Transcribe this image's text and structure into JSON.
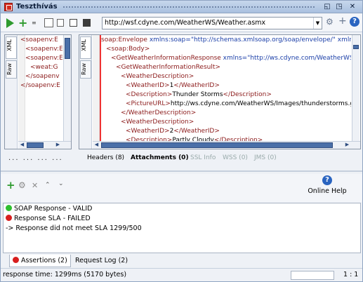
{
  "window": {
    "title": "Teszthívás"
  },
  "toolbar": {
    "url": "http://wsf.cdyne.com/WeatherWS/Weather.asmx"
  },
  "request_panel": {
    "tabs": [
      "XML",
      "Raw"
    ],
    "lines": [
      {
        "t": "<soapenv:E"
      },
      {
        "t": "<soapenv:E"
      },
      {
        "t": "<soapenv:E"
      },
      {
        "t": "<weat:G"
      },
      {
        "t": "</soapenv"
      },
      {
        "t": "</soapenv:E"
      }
    ],
    "more": "... ... ... ..."
  },
  "response_panel": {
    "tabs": [
      "XML",
      "Raw"
    ],
    "lines": [
      {
        "indent": 0,
        "tag": "soap:Envelope",
        "attr": " xmlns:soap=",
        "val": "\"http://schemas.xmlsoap.org/soap/envelope/\"",
        "rest": " xmlns:xsi="
      },
      {
        "indent": 1,
        "tag": "<soap:Body>"
      },
      {
        "indent": 2,
        "tag": "<GetWeatherInformationResponse",
        "attr": " xmlns=",
        "val": "\"http://ws.cdyne.com/WeatherWS/\"",
        "close": ">"
      },
      {
        "indent": 3,
        "tag": "<GetWeatherInformationResult>"
      },
      {
        "indent": 4,
        "tag": "<WeatherDescription>"
      },
      {
        "indent": 5,
        "tag": "<WeatherID>",
        "text": "1",
        "endtag": "</WeatherID>"
      },
      {
        "indent": 5,
        "tag": "<Description>",
        "text": "Thunder Storms",
        "endtag": "</Description>"
      },
      {
        "indent": 5,
        "tag": "<PictureURL>",
        "text": "http://ws.cdyne.com/WeatherWS/Images/thunderstorms.gif",
        "endtag": "</Pi"
      },
      {
        "indent": 4,
        "tag": "</WeatherDescription>"
      },
      {
        "indent": 4,
        "tag": "<WeatherDescription>"
      },
      {
        "indent": 5,
        "tag": "<WeatherID>",
        "text": "2",
        "endtag": "</WeatherID>"
      },
      {
        "indent": 5,
        "tag": "<Description>",
        "text": "Partly Cloudy",
        "endtag": "</Description>"
      }
    ],
    "tabs_bottom": {
      "headers": "Headers (8)",
      "attachments": "Attachments (0)",
      "ssl": "SSL Info",
      "wss": "WSS (0)",
      "jms": "JMS (0)"
    }
  },
  "assertions": {
    "online_help": "Online Help",
    "items": [
      {
        "status": "valid",
        "text": "SOAP Response - VALID",
        "color": "#2fbf2f"
      },
      {
        "status": "failed",
        "text": "Response SLA - FAILED",
        "color": "#d81e1e"
      },
      {
        "status": "detail",
        "text": "-> Response did not meet SLA 1299/500"
      }
    ],
    "tabs": {
      "assertions": "Assertions (2)",
      "log": "Request Log (2)"
    }
  },
  "status": {
    "text": "response time: 1299ms (5170 bytes)",
    "position": "1 : 1"
  },
  "colors": {
    "accent": "#4a6fa8",
    "tag": "#8b1a1a",
    "attr": "#1b3fa8"
  }
}
